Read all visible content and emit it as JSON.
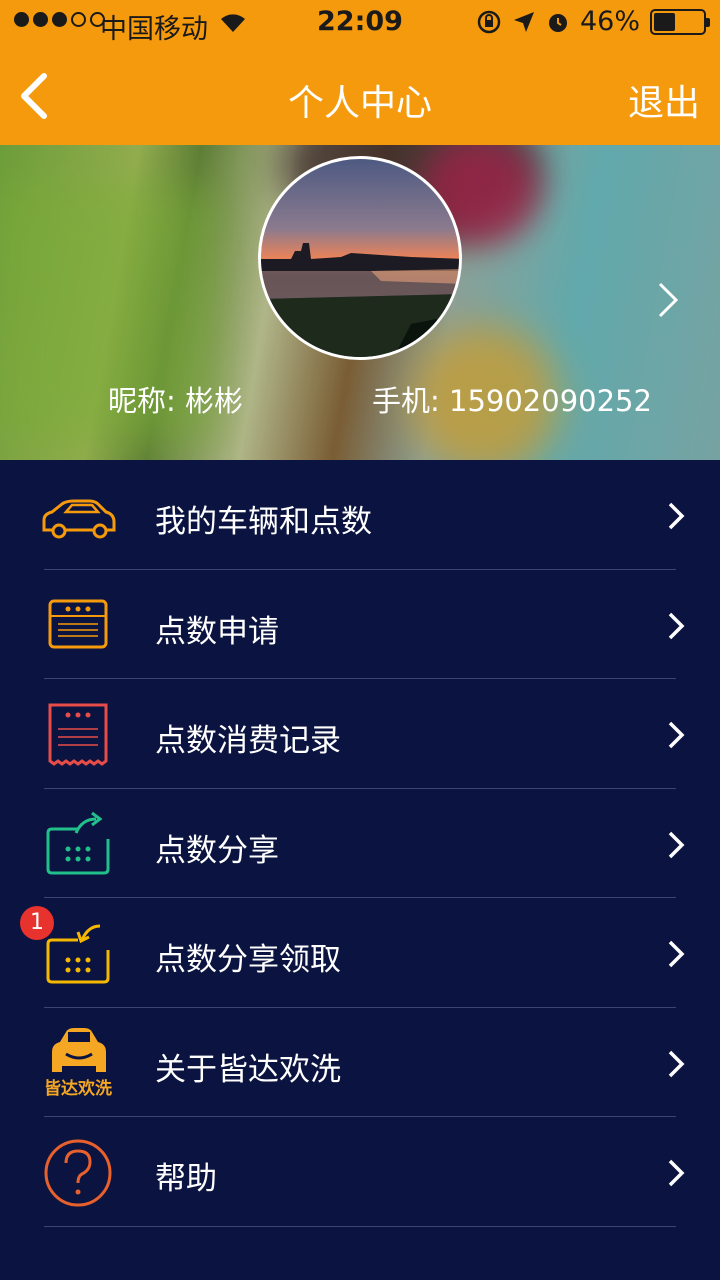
{
  "status_bar": {
    "carrier": "中国移动",
    "time": "22:09",
    "battery": "46%"
  },
  "nav": {
    "title": "个人中心",
    "logout": "退出"
  },
  "profile": {
    "nickname_label": "昵称: 彬彬",
    "phone_label": "手机: 15902090252"
  },
  "menu": {
    "items": [
      {
        "label": "我的车辆和点数",
        "icon": "car-outline-icon",
        "color": "#f59a0c"
      },
      {
        "label": "点数申请",
        "icon": "application-form-icon",
        "color": "#f59a0c"
      },
      {
        "label": "点数消费记录",
        "icon": "receipt-icon",
        "color": "#e84c48"
      },
      {
        "label": "点数分享",
        "icon": "share-calendar-icon",
        "color": "#21c08b"
      },
      {
        "label": "点数分享领取",
        "icon": "receive-share-icon",
        "color": "#f5b800",
        "badge": "1"
      },
      {
        "label": "关于皆达欢洗",
        "icon": "app-logo-icon",
        "color": "#f5a623",
        "logo_text": "皆达欢洗"
      },
      {
        "label": "帮助",
        "icon": "help-question-icon",
        "color": "#e8612c"
      }
    ]
  },
  "colors": {
    "header": "#f59a0c",
    "background": "#0b1440",
    "divider": "#3b4570",
    "badge": "#e8322d"
  }
}
